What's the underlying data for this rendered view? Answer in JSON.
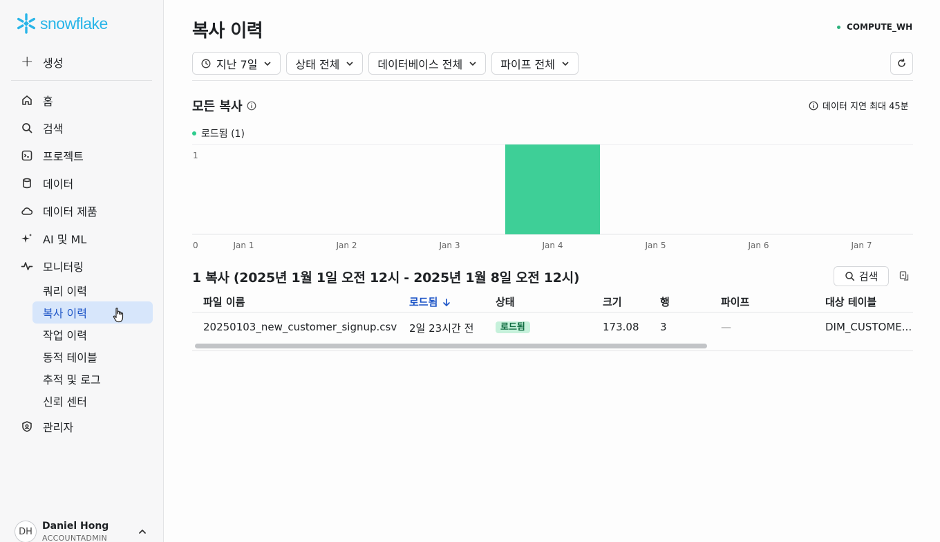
{
  "brand": {
    "name": "snowflake",
    "color": "#29b5e8"
  },
  "sidebar": {
    "create_label": "생성",
    "items": [
      {
        "label": "홈",
        "icon": "home-icon"
      },
      {
        "label": "검색",
        "icon": "search-icon"
      },
      {
        "label": "프로젝트",
        "icon": "project-icon"
      },
      {
        "label": "데이터",
        "icon": "database-icon"
      },
      {
        "label": "데이터 제품",
        "icon": "cloud-icon"
      },
      {
        "label": "AI 및 ML",
        "icon": "sparkle-icon"
      },
      {
        "label": "모니터링",
        "icon": "activity-icon"
      }
    ],
    "monitoring_sub": [
      {
        "label": "쿼리 이력",
        "active": false
      },
      {
        "label": "복사 이력",
        "active": true
      },
      {
        "label": "작업 이력",
        "active": false
      },
      {
        "label": "동적 테이블",
        "active": false
      },
      {
        "label": "추적 및 로그",
        "active": false
      },
      {
        "label": "신뢰 센터",
        "active": false
      }
    ],
    "admin_label": "관리자",
    "user": {
      "initials": "DH",
      "name": "Daniel Hong",
      "role": "ACCOUNTADMIN"
    }
  },
  "header": {
    "title": "복사 이력",
    "warehouse": "COMPUTE_WH",
    "warehouse_status_color": "#2cb27d"
  },
  "filters": {
    "time": "지난 7일",
    "status": "상태 전체",
    "database": "데이터베이스 전체",
    "pipe": "파이프 전체"
  },
  "section": {
    "title": "모든 복사",
    "latency_note": "데이터 지연 최대 45분"
  },
  "chart_data": {
    "type": "bar",
    "categories": [
      "Jan 1",
      "Jan 2",
      "Jan 3",
      "Jan 4",
      "Jan 5",
      "Jan 6",
      "Jan 7"
    ],
    "series": [
      {
        "name": "로드됨 (1)",
        "values": [
          0,
          0,
          0,
          1,
          0,
          0,
          0
        ],
        "color": "#3ecf97"
      }
    ],
    "ylim": [
      0,
      1
    ],
    "yticks": [
      "0",
      "1"
    ],
    "grid": true,
    "legend": "top-left"
  },
  "table": {
    "title": "1 복사 (2025년 1월 1일 오전 12시 - 2025년 1월 8일 오전 12시)",
    "search_label": "검색",
    "columns": {
      "file": "파일 이름",
      "loaded": "로드됨",
      "status": "상태",
      "size": "크기",
      "rows": "행",
      "pipe": "파이프",
      "target": "대상 테이블"
    },
    "rows": [
      {
        "file": "20250103_new_customer_signup.csv",
        "loaded": "2일 23시간 전",
        "status": "로드됨",
        "size": "173.08",
        "rows": "3",
        "pipe": "—",
        "target": "DIM_CUSTOME..."
      }
    ],
    "scroll_position": 0.71
  }
}
